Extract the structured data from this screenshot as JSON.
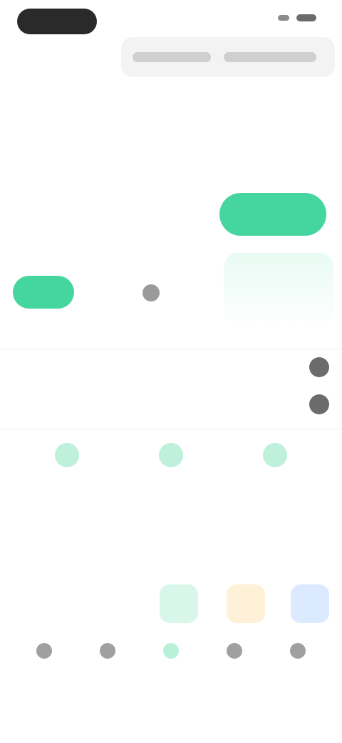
{
  "status": {},
  "header": {},
  "profile": {},
  "actions": {},
  "list": {},
  "features": {},
  "category": {},
  "metrics": {},
  "bottom_nav": {},
  "colors": {
    "accent": "#45d6a0",
    "muted_text": "#8b8b8b",
    "dark_text": "#2a2a2a"
  },
  "icons": {
    "status_wifi": "wifi-icon",
    "status_battery": "battery-icon",
    "quick_center": "dot-icon",
    "row1": "chevron-icon",
    "row2": "chevron-icon",
    "feature1": "feature-icon-1",
    "feature2": "feature-icon-2",
    "feature3": "feature-icon-3",
    "nav_home": "home-icon",
    "nav_discover": "compass-icon",
    "nav_wallet": "wallet-icon",
    "nav_messages": "chat-icon",
    "nav_profile": "user-icon"
  }
}
